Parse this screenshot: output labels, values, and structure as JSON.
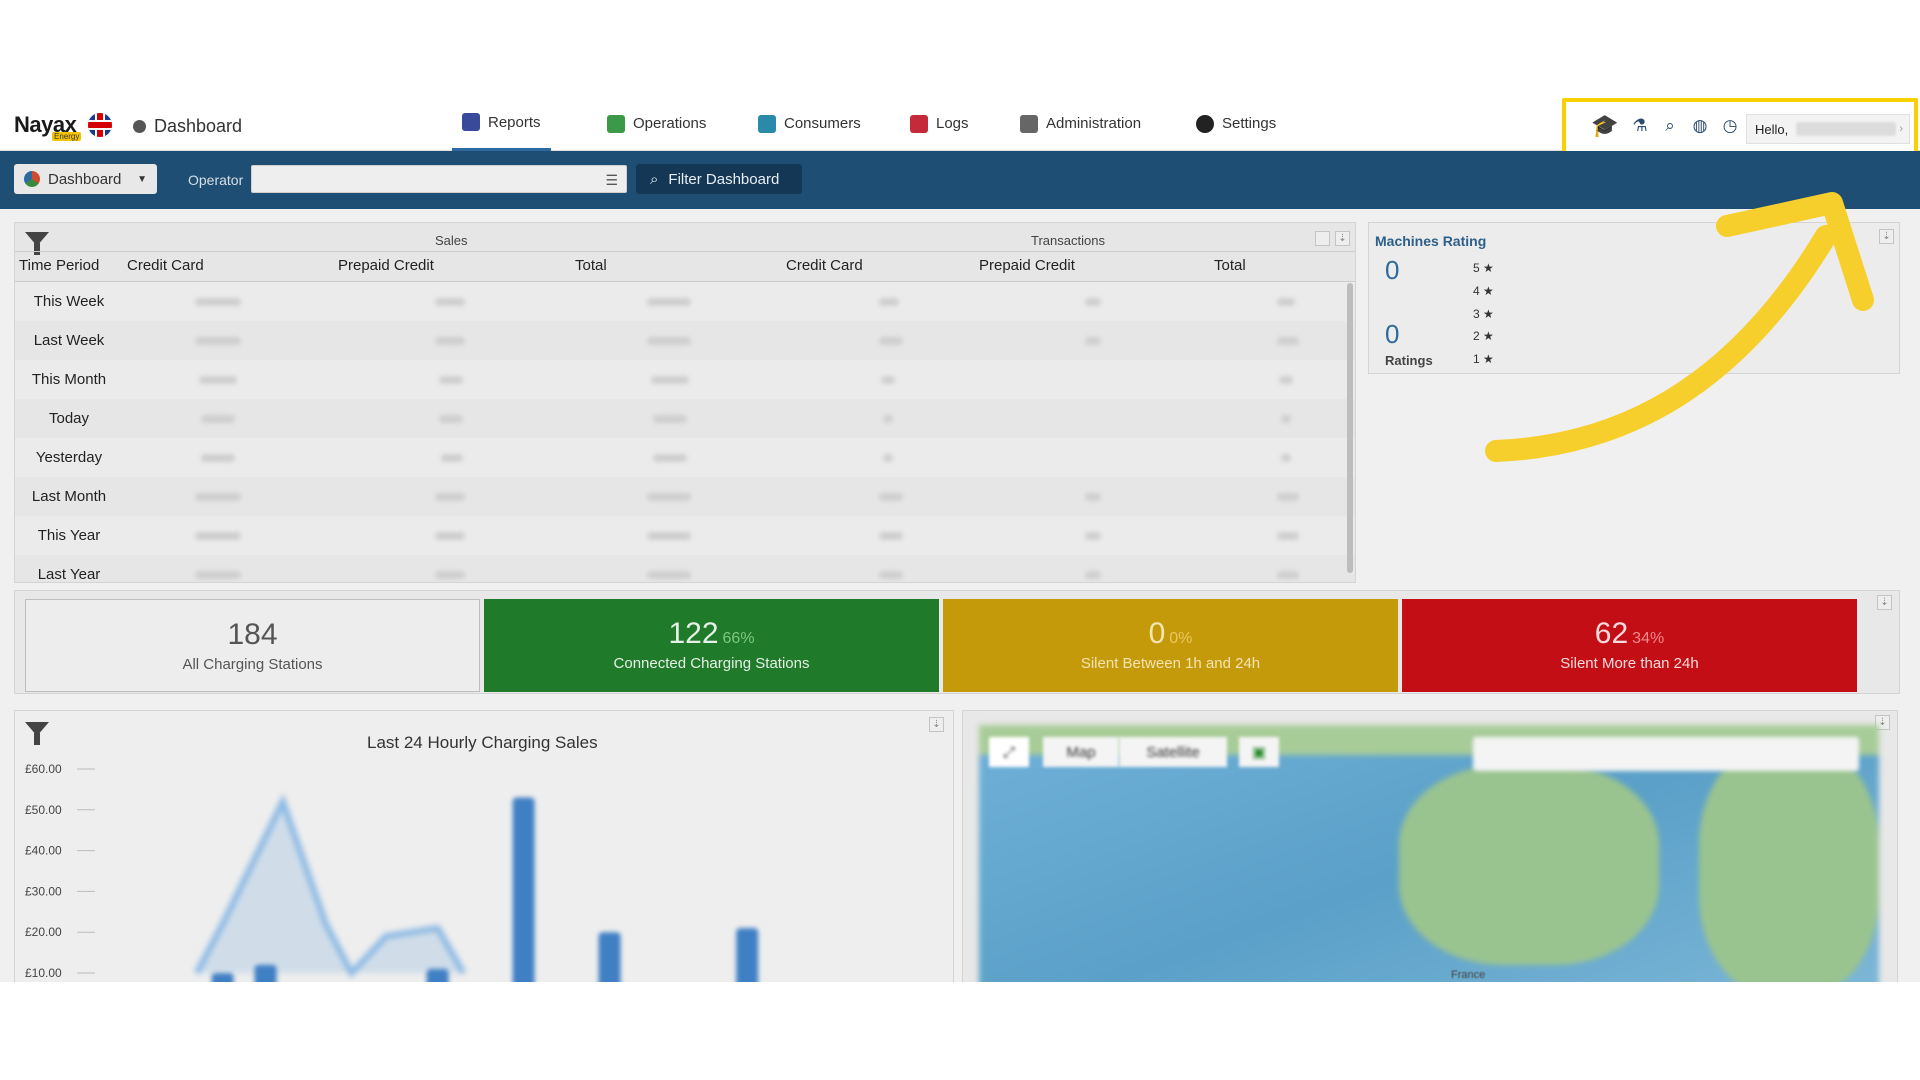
{
  "app": {
    "brand": "Nayax",
    "brand_sub": "Energy",
    "crumb": "Dashboard"
  },
  "nav": [
    {
      "label": "Reports",
      "icon": "reports-icon",
      "color": "#3a4a9a"
    },
    {
      "label": "Operations",
      "icon": "operations-icon",
      "color": "#3a9a4a"
    },
    {
      "label": "Consumers",
      "icon": "consumers-icon",
      "color": "#2a8aaa"
    },
    {
      "label": "Logs",
      "icon": "logs-icon",
      "color": "#c42a3a"
    },
    {
      "label": "Administration",
      "icon": "administration-icon",
      "color": "#666666"
    },
    {
      "label": "Settings",
      "icon": "settings-icon",
      "color": "#222222"
    }
  ],
  "toolbox": {
    "hello": "Hello,"
  },
  "toolbar": {
    "dashboard": "Dashboard",
    "operator_label": "Operator",
    "filter": "Filter Dashboard"
  },
  "sales": {
    "group_sales": "Sales",
    "group_transactions": "Transactions",
    "headers": [
      "Time Period",
      "Credit Card",
      "Prepaid Credit",
      "Total",
      "Credit Card",
      "Prepaid Credit",
      "Total"
    ],
    "rows": [
      "This Week",
      "Last Week",
      "This Month",
      "Today",
      "Yesterday",
      "Last Month",
      "This Year",
      "Last Year"
    ]
  },
  "rating": {
    "title": "Machines Rating",
    "value1": "0",
    "value2": "0",
    "ratings_label": "Ratings",
    "stars": [
      "5 ★",
      "4 ★",
      "3 ★",
      "2 ★",
      "1 ★"
    ]
  },
  "stats": [
    {
      "num": "184",
      "pct": "",
      "label": "All Charging Stations",
      "bg": "#ededed",
      "fg": "#555555"
    },
    {
      "num": "122",
      "pct": "66%",
      "label": "Connected Charging Stations",
      "bg": "#1f7a2a",
      "fg": "#e6f0e6"
    },
    {
      "num": "0",
      "pct": "0%",
      "label": "Silent Between 1h and 24h",
      "bg": "#c49a0a",
      "fg": "#f3e4b0"
    },
    {
      "num": "62",
      "pct": "34%",
      "label": "Silent More than 24h",
      "bg": "#c40e16",
      "fg": "#f6dcdc"
    }
  ],
  "chart_data": {
    "type": "bar",
    "title": "Last 24 Hourly Charging Sales",
    "yticks": [
      "£60.00",
      "£50.00",
      "£40.00",
      "£30.00",
      "£20.00",
      "£10.00"
    ],
    "ylim": [
      10,
      60
    ],
    "bars": [
      {
        "pos": 0.16,
        "value": 10
      },
      {
        "pos": 0.21,
        "value": 12
      },
      {
        "pos": 0.41,
        "value": 11
      },
      {
        "pos": 0.51,
        "value": 53
      },
      {
        "pos": 0.61,
        "value": 20
      },
      {
        "pos": 0.77,
        "value": 21
      }
    ],
    "area": [
      [
        0.13,
        10
      ],
      [
        0.16,
        22
      ],
      [
        0.23,
        52
      ],
      [
        0.28,
        22
      ],
      [
        0.31,
        10
      ],
      [
        0.35,
        19
      ],
      [
        0.41,
        21
      ],
      [
        0.44,
        10
      ]
    ]
  },
  "map": {
    "tab_map": "Map",
    "tab_satellite": "Satellite",
    "label_france": "France"
  }
}
